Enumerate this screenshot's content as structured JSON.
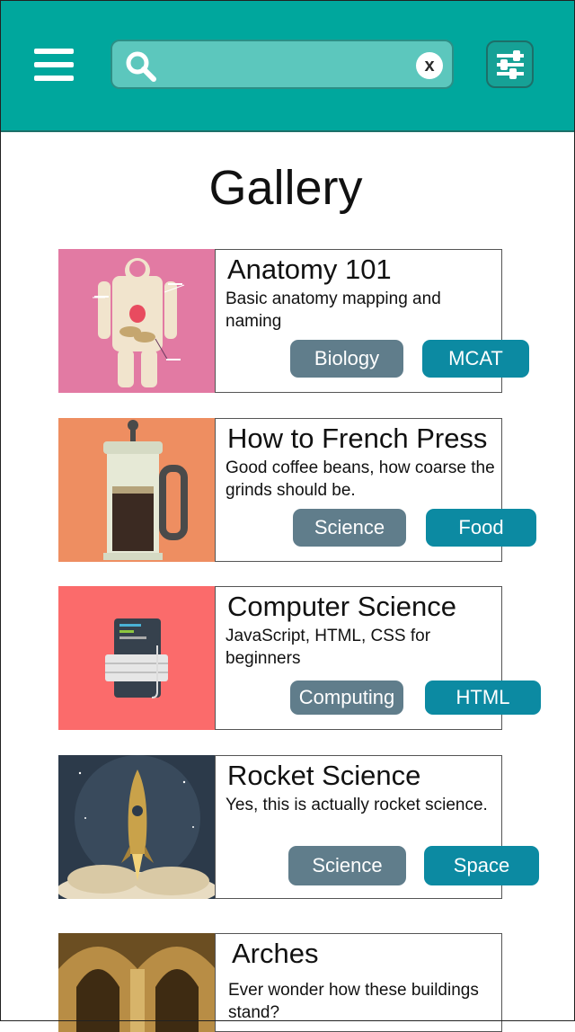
{
  "header": {
    "search_placeholder": "",
    "clear_label": "x"
  },
  "page": {
    "title": "Gallery"
  },
  "cards": [
    {
      "title": "Anatomy 101",
      "description": "Basic anatomy mapping and naming",
      "tags": [
        "Biology",
        "MCAT"
      ]
    },
    {
      "title": "How to French Press",
      "description": "Good coffee beans, how coarse the grinds should be.",
      "tags": [
        "Science",
        "Food"
      ]
    },
    {
      "title": "Computer Science",
      "description": "JavaScript, HTML, CSS for beginners",
      "tags": [
        "Computing",
        "HTML"
      ]
    },
    {
      "title": "Rocket Science",
      "description": "Yes, this is actually rocket science.",
      "tags": [
        "Science",
        "Space"
      ]
    },
    {
      "title": "Arches",
      "description": "Ever wonder how these buildings stand?",
      "tags": []
    }
  ],
  "colors": {
    "header_bg": "#00a79d",
    "search_bg": "#5cc7bd",
    "tag_gray": "#607d8b",
    "tag_teal": "#0c8aa2",
    "thumb_anatomy": "#e27aa3",
    "thumb_coffee": "#ee8e61",
    "thumb_computer": "#fb6b6b"
  }
}
